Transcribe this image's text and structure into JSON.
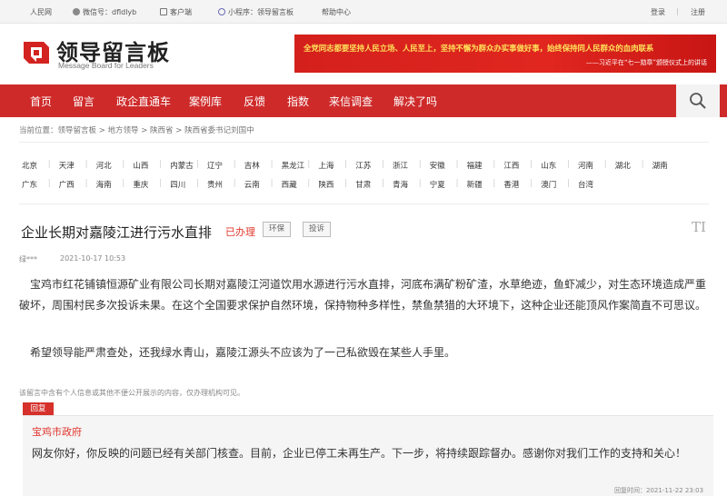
{
  "topbar": {
    "people_net": "人民网",
    "wechat": "微信号：dfldlyb",
    "client": "客户端",
    "mini_program": "小程序：领导留言板",
    "help": "帮助中心",
    "login": "登录",
    "register": "注册",
    "separator": "|"
  },
  "header": {
    "logo_cn": "领导留言板",
    "logo_en": "Message Board for Leaders",
    "banner_line1": "全党同志都要坚持人民立场、人民至上，坚持不懈为群众办实事做好事，始终保持同人民群众的血肉联系",
    "banner_line2": "——习近平在“七一勋章”颁授仪式上的讲话",
    "brand_color": "#cf2a2a"
  },
  "nav": {
    "items": [
      "首页",
      "留言",
      "政企直通车",
      "案例库",
      "反馈",
      "指数",
      "来信调查",
      "解决了吗"
    ],
    "search_icon": "search-icon"
  },
  "breadcrumb": {
    "text": "当前位置：领导留言板 > 地方领导 > 陕西省 > 陕西省委书记刘国中"
  },
  "provinces": {
    "row1": [
      "北京",
      "天津",
      "河北",
      "山西",
      "内蒙古",
      "辽宁",
      "吉林",
      "黑龙江",
      "上海",
      "江苏",
      "浙江",
      "安徽",
      "福建",
      "江西",
      "山东",
      "河南",
      "湖北",
      "湖南"
    ],
    "row2": [
      "广东",
      "广西",
      "海南",
      "重庆",
      "四川",
      "贵州",
      "云南",
      "西藏",
      "陕西",
      "甘肃",
      "青海",
      "宁夏",
      "新疆",
      "香港",
      "澳门",
      "台湾"
    ]
  },
  "post": {
    "title": "企业长期对嘉陵江进行污水直排",
    "status": "已办理",
    "tags": [
      "环保",
      "投诉"
    ],
    "author": "绿***",
    "time": "2021-10-17 10:53",
    "paragraph1": "宝鸡市红花铺镇恒源矿业有限公司长期对嘉陵江河道饮用水源进行污水直排，河底布满矿粉矿渣，水草绝迹，鱼虾减少，对生态环境造成严重破坏，周围村民多次投诉未果。在这个全国要求保护自然环境，保持物种多样性，禁鱼禁猎的大环境下，这种企业还能顶风作案简直不可思议。",
    "paragraph2": "希望领导能严肃查处，还我绿水青山，嘉陵江源头不应该为了一己私欲毁在某些人手里。",
    "privacy_note": "该留言中含有个人信息或其他不便公开展示的内容，仅办理机构可见。"
  },
  "reply": {
    "label": "回复",
    "from": "宝鸡市政府",
    "text": "网友你好，你反映的问题已经有关部门核查。目前，企业已停工未再生产。下一步，将持续跟踪督办。感谢你对我们工作的支持和关心！",
    "time": "回复时间：2021-11-22 23:03"
  }
}
